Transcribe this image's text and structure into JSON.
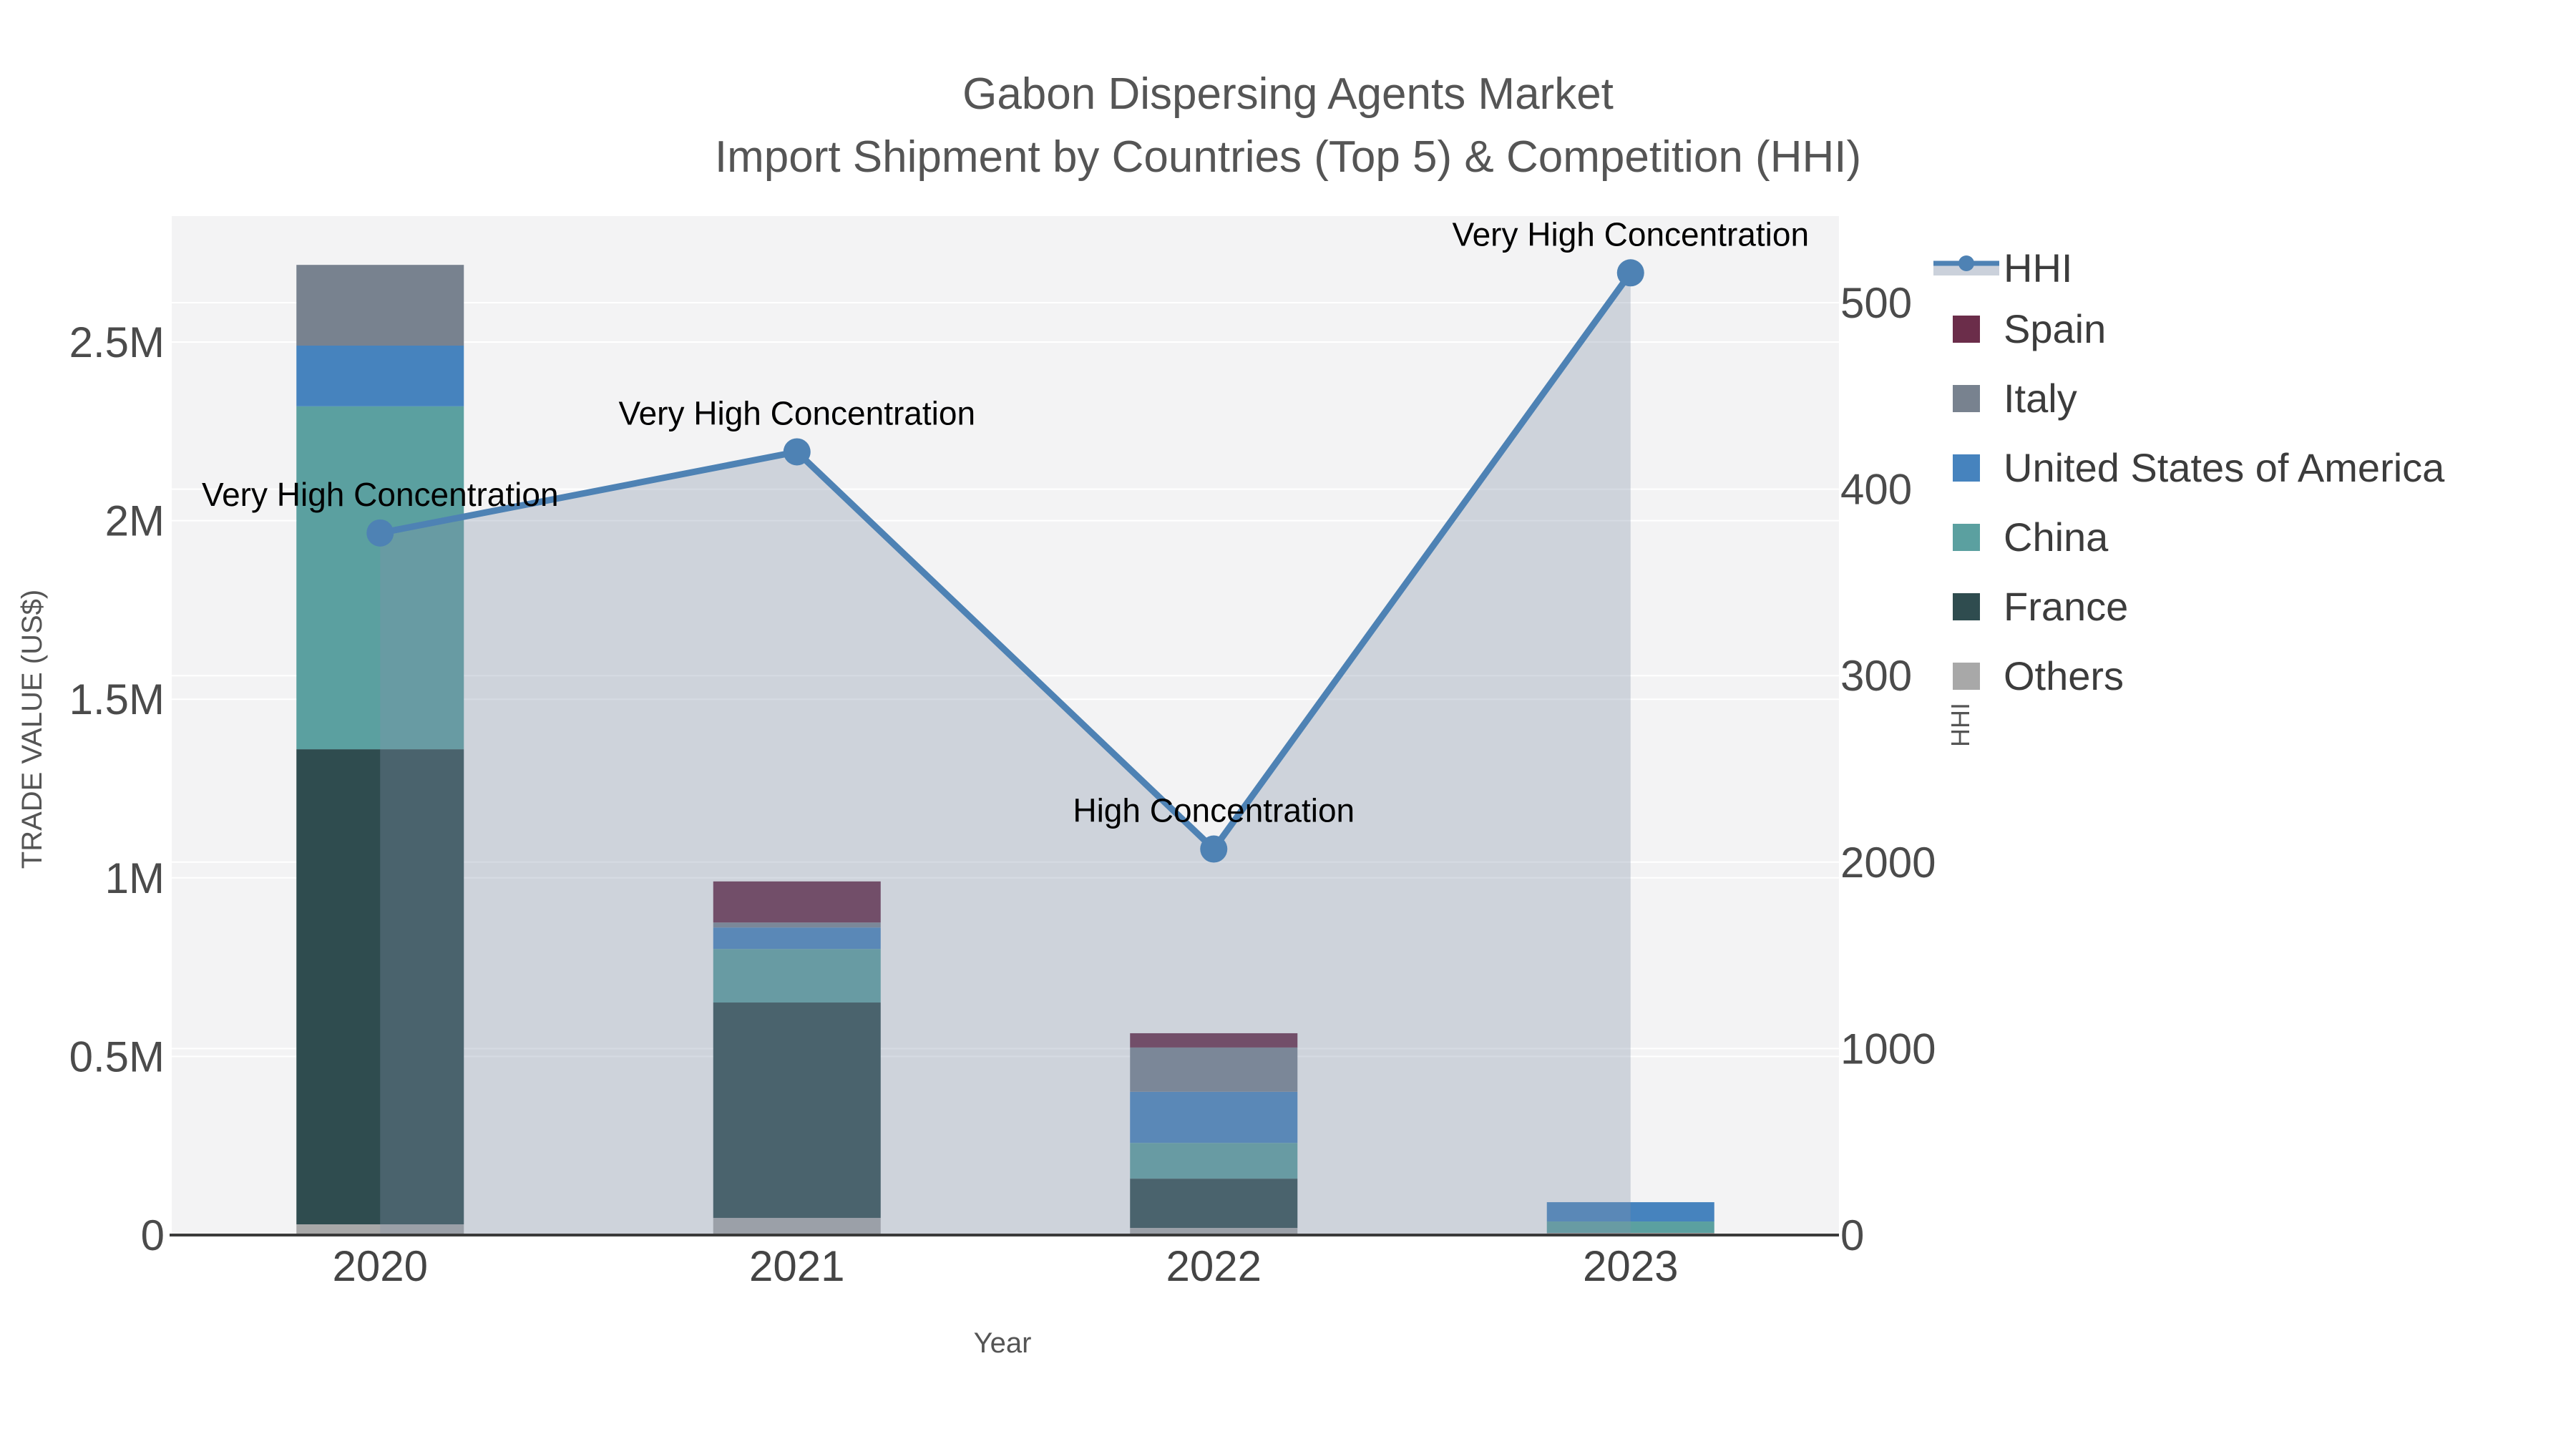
{
  "title": {
    "line1": "Gabon Dispersing Agents Market",
    "line2": "Import Shipment by Countries (Top 5) & Competition (HHI)"
  },
  "chart_data": {
    "type": "bar+line",
    "categories": [
      "2020",
      "2021",
      "2022",
      "2023"
    ],
    "x_title": "Year",
    "y_left": {
      "title": "TRADE VALUE (US$)",
      "unit": "M US$",
      "tick_values": [
        0,
        0.5,
        1,
        1.5,
        2,
        2.5
      ],
      "tick_labels": [
        "0",
        "0.5M",
        "1M",
        "1.5M",
        "2M",
        "2.5M"
      ]
    },
    "y_right": {
      "title": "HHI",
      "tick_values": [
        0,
        1000,
        2000,
        3000,
        4000,
        5000
      ],
      "tick_labels": [
        "0",
        "1000",
        "2000",
        "300",
        "400",
        "500"
      ]
    },
    "bar_series_bottom_to_top": [
      {
        "name": "Others",
        "color": "#A8A8A8",
        "values": [
          0.03,
          0.048,
          0.02,
          0.006
        ]
      },
      {
        "name": "France",
        "color": "#2F4C4F",
        "values": [
          1.33,
          0.603,
          0.138,
          0.0
        ]
      },
      {
        "name": "China",
        "color": "#5BA0A0",
        "values": [
          0.96,
          0.15,
          0.1,
          0.032
        ]
      },
      {
        "name": "United States of America",
        "color": "#4683BE",
        "values": [
          0.17,
          0.06,
          0.143,
          0.054
        ]
      },
      {
        "name": "Italy",
        "color": "#78828F",
        "values": [
          0.226,
          0.014,
          0.124,
          0.0
        ]
      },
      {
        "name": "Spain",
        "color": "#6B2D4A",
        "values": [
          0.0,
          0.115,
          0.04,
          0.0
        ]
      }
    ],
    "line_series": {
      "name": "HHI",
      "color": "#4E82B4",
      "area_fill": "rgba(131,145,170,0.33)",
      "values": [
        3765,
        4200,
        2070,
        5160
      ]
    },
    "annotations": [
      {
        "category": "2020",
        "text": "Very High Concentration"
      },
      {
        "category": "2021",
        "text": "Very High Concentration"
      },
      {
        "category": "2022",
        "text": "High Concentration"
      },
      {
        "category": "2023",
        "text": "Very High Concentration"
      }
    ],
    "legend": [
      {
        "label": "HHI",
        "symbol": "line-marker",
        "color": "#4E82B4",
        "band_color": "#CBD1DB"
      },
      {
        "label": "Spain",
        "symbol": "square",
        "color": "#6B2D4A"
      },
      {
        "label": "Italy",
        "symbol": "square",
        "color": "#78828F"
      },
      {
        "label": "United States of America",
        "symbol": "square",
        "color": "#4683BE"
      },
      {
        "label": "China",
        "symbol": "square",
        "color": "#5BA0A0"
      },
      {
        "label": "France",
        "symbol": "square",
        "color": "#2F4C4F"
      },
      {
        "label": "Others",
        "symbol": "square",
        "color": "#A8A8A8"
      }
    ],
    "colors": {
      "plot_bg": "#F3F3F4",
      "gridline": "#FFFFFF",
      "axis_line": "#3A3A3A",
      "tick_text": "#4B4B4B",
      "axis_title_text": "#555555",
      "legend_text": "#3C3C3C",
      "annotation_text": "#000000"
    }
  }
}
